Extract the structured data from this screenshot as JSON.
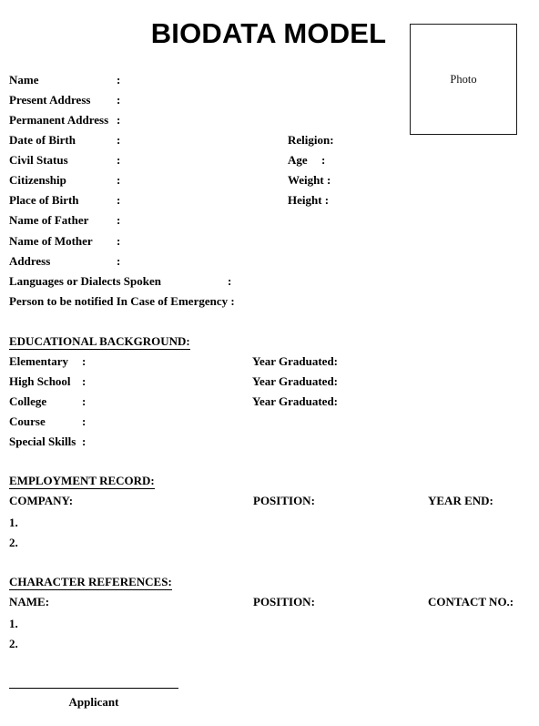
{
  "document": {
    "title": "BIODATA MODEL",
    "photo_box_label": "Photo"
  },
  "personal": {
    "left_fields": [
      {
        "label": "Name",
        "colon": ":"
      },
      {
        "label": "Present Address",
        "colon": ":"
      },
      {
        "label": "Permanent Address",
        "colon": ":"
      },
      {
        "label": "Date of Birth",
        "colon": ":"
      },
      {
        "label": "Civil Status",
        "colon": ":"
      },
      {
        "label": "Citizenship",
        "colon": ":"
      },
      {
        "label": "Place of Birth",
        "colon": ":"
      },
      {
        "label": "Name of Father",
        "colon": ":"
      },
      {
        "label": "Name of Mother",
        "colon": ":"
      },
      {
        "label": "Address",
        "colon": ":"
      }
    ],
    "wide_fields": [
      {
        "label": "Languages or Dialects Spoken",
        "colon": ":"
      },
      {
        "label": "Person to be notified In Case of Emergency :",
        "colon": ""
      }
    ],
    "right_fields": [
      {
        "label": "Religion:"
      },
      {
        "label": "Age",
        "colon": ":"
      },
      {
        "label": "Weight :"
      },
      {
        "label": "Height  :"
      }
    ]
  },
  "education": {
    "heading": "EDUCATIONAL BACKGROUND:",
    "rows": [
      {
        "label": "Elementary",
        "colon": ":",
        "right": "Year Graduated:"
      },
      {
        "label": "High School",
        "colon": ":",
        "right": "Year Graduated:"
      },
      {
        "label": "College",
        "colon": ":",
        "right": "Year Graduated:"
      },
      {
        "label": "Course",
        "colon": ":",
        "right": ""
      },
      {
        "label": "Special Skills",
        "colon": ":",
        "right": ""
      }
    ]
  },
  "employment": {
    "heading": "EMPLOYMENT RECORD:",
    "columns": {
      "company": "COMPANY:",
      "position": "POSITION:",
      "year_end": "YEAR END:"
    },
    "rows": [
      "1.",
      "2."
    ]
  },
  "references": {
    "heading": "CHARACTER REFERENCES:",
    "columns": {
      "name": "NAME:",
      "position": "POSITION:",
      "contact": "CONTACT NO.:"
    },
    "rows": [
      "1.",
      "2."
    ]
  },
  "footer": {
    "applicant_label": "Applicant"
  }
}
